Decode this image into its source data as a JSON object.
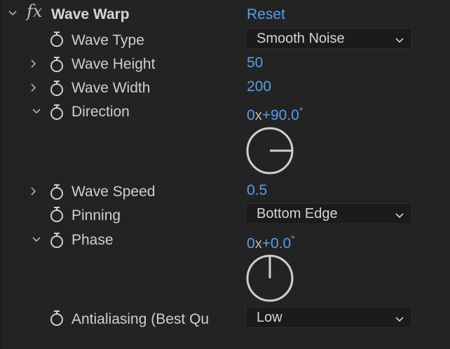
{
  "effect": {
    "name": "Wave Warp",
    "fx_symbol": "fx",
    "reset_label": "Reset"
  },
  "properties": {
    "wave_type": {
      "label": "Wave Type",
      "value": "Smooth Noise"
    },
    "wave_height": {
      "label": "Wave Height",
      "value": "50"
    },
    "wave_width": {
      "label": "Wave Width",
      "value": "200"
    },
    "direction": {
      "label": "Direction",
      "revolutions": "0",
      "x": "x",
      "angle": "+90.0",
      "degree": "°",
      "dial_angle_deg": 90
    },
    "wave_speed": {
      "label": "Wave Speed",
      "value": "0.5"
    },
    "pinning": {
      "label": "Pinning",
      "value": "Bottom Edge"
    },
    "phase": {
      "label": "Phase",
      "revolutions": "0",
      "x": "x",
      "angle": "+0.0",
      "degree": "°",
      "dial_angle_deg": 0
    },
    "antialiasing": {
      "label": "Antialiasing (Best Qu",
      "value": "Low"
    }
  },
  "colors": {
    "background": "#232323",
    "value_blue": "#5a9ee8",
    "label": "#cfcfcf",
    "dropdown_bg": "#1b1b1b"
  }
}
